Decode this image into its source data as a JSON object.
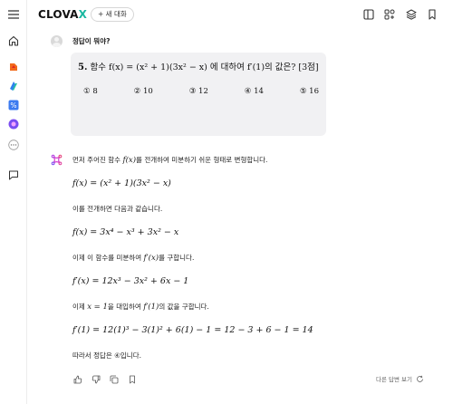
{
  "app": {
    "logo_text": "CLOVA",
    "logo_x": "X",
    "new_chat_label": "+ 새 대화"
  },
  "sidebar": {
    "icons": [
      "menu-icon",
      "home-icon",
      "clova-note-icon",
      "clova-studio-icon",
      "percent-app-icon",
      "clova-dub-icon",
      "more-apps-icon",
      "feedback-icon"
    ]
  },
  "toolbar": {
    "icons": [
      "sidebar-toggle-icon",
      "skills-icon",
      "layers-icon",
      "bookmark-icon"
    ]
  },
  "user_message": {
    "text": "정답이 뭐야?",
    "question_number": "5.",
    "question_text": "함수 f(x) = (x² + 1)(3x² − x) 에 대하여 f′(1)의 값은? [3점]",
    "options": [
      "① 8",
      "② 10",
      "③ 12",
      "④ 14",
      "⑤ 16"
    ]
  },
  "answer": {
    "p1_a": "먼저 주어진 함수 ",
    "p1_m": "f(x)",
    "p1_b": "를 전개하여 미분하기 쉬운 형태로 변형합니다.",
    "eq1": "f(x) = (x² + 1)(3x² − x)",
    "p2": "이를 전개하면 다음과 같습니다.",
    "eq2": "f(x) = 3x⁴ − x³ + 3x² − x",
    "p3_a": "이제 이 함수를 미분하여 ",
    "p3_m": "f′(x)",
    "p3_b": "를 구합니다.",
    "eq3": "f′(x) = 12x³ − 3x² + 6x − 1",
    "p4_a": "이제 ",
    "p4_m1": "x = 1",
    "p4_b": "을 대입하여 ",
    "p4_m2": "f′(1)",
    "p4_c": "의 값을 구합니다.",
    "eq4": "f′(1) = 12(1)³ − 3(1)² + 6(1) − 1 = 12 − 3 + 6 − 1 = 14",
    "p5": "따라서 정답은 ④입니다."
  },
  "actions": {
    "regenerate_label": "다른 답변 보기"
  }
}
